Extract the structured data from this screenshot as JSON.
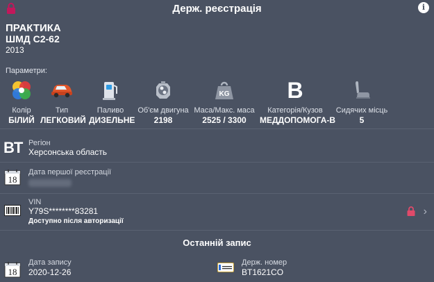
{
  "header": {
    "title": "Держ. реєстрація"
  },
  "icons": {
    "lock_top": "lock-icon",
    "info": "info-icon",
    "lock_vin": "lock-icon-red",
    "chevron": "chevron-right-icon"
  },
  "colors": {
    "background": "#4a5262",
    "lock_top": "#c2185b",
    "lock_vin": "#e04a6a"
  },
  "car": {
    "make": "ПРАКТИКА",
    "model": "ШМД С2-62",
    "year": "2013"
  },
  "params": {
    "title": "Параметри:",
    "items": [
      {
        "icon": "color-palette-icon",
        "label": "Колір",
        "value": "БІЛИЙ"
      },
      {
        "icon": "car-type-icon",
        "label": "Тип",
        "value": "ЛЕГКОВИЙ"
      },
      {
        "icon": "fuel-pump-icon",
        "label": "Паливо",
        "value": "ДИЗЕЛЬНЕ"
      },
      {
        "icon": "engine-icon",
        "label": "Об'єм двигуна",
        "value": "2198"
      },
      {
        "icon": "weight-icon",
        "label": "Маса/Макс. маса",
        "value": "2525 / 3300",
        "badge": "KG"
      },
      {
        "icon": "category-b-icon",
        "label": "Категорія/Кузов",
        "value": "МЕДДОПОМОГА-В",
        "badge": "B"
      },
      {
        "icon": "seat-icon",
        "label": "Сидячих місць",
        "value": "5"
      }
    ]
  },
  "region": {
    "code": "BT",
    "label": "Регіон",
    "value": "Херсонська область"
  },
  "first_registration": {
    "calendar_day": "18",
    "label": "Дата першої реєстрації"
  },
  "vin": {
    "label": "VIN",
    "value": "Y79S********83281",
    "note": "Доступно після авторизації"
  },
  "last_record": {
    "title": "Останній запис",
    "date_label": "Дата запису",
    "date_value": "2020-12-26",
    "calendar_day": "18",
    "plate_label": "Держ. номер",
    "plate_value": "BT1621CO"
  }
}
